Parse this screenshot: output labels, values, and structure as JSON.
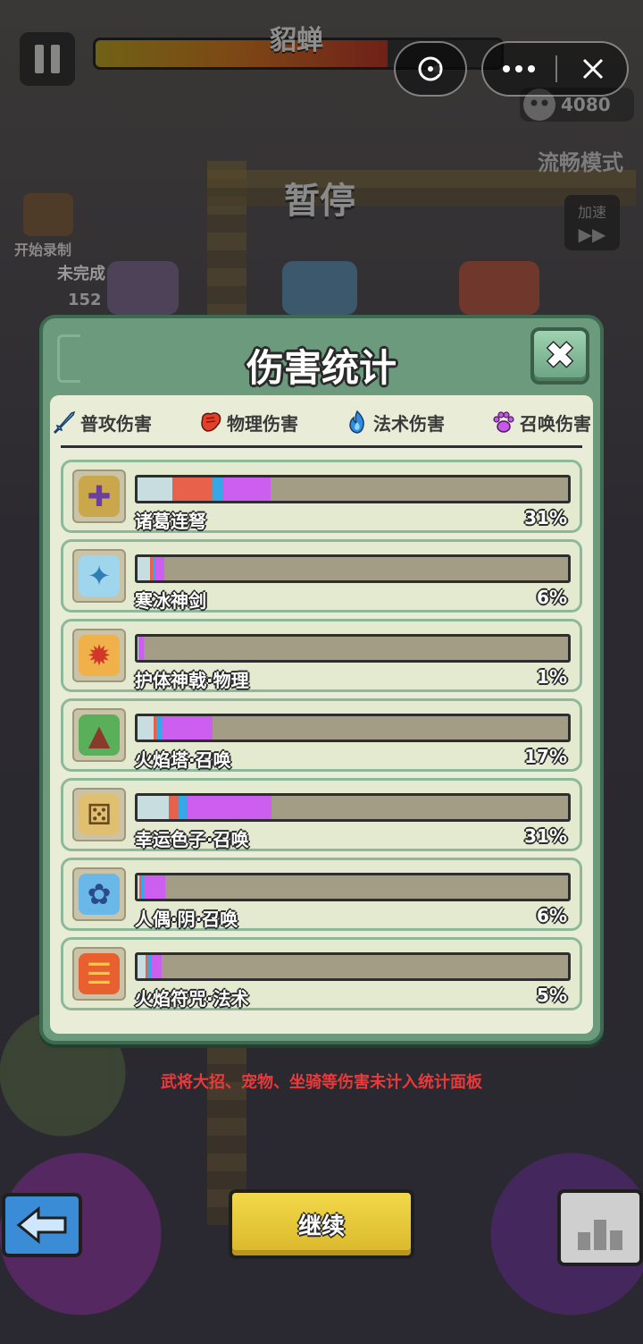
{
  "hud": {
    "boss_name": "貂蝉",
    "boss_hp_fraction": 0.72,
    "kill_count": "4080",
    "smooth_mode_label": "流畅模式",
    "speed_label": "加速",
    "record_label": "开始录制",
    "unfinished_label": "未完成",
    "count_value": "152",
    "pause_title": "暂停"
  },
  "dialog": {
    "title": "伤害统计",
    "legend": [
      {
        "label": "普攻伤害",
        "icon": "sword-icon",
        "color": "#37a8e6"
      },
      {
        "label": "物理伤害",
        "icon": "fist-icon",
        "color": "#e8614a"
      },
      {
        "label": "法术伤害",
        "icon": "flame-icon",
        "color": "#37a8e6"
      },
      {
        "label": "召唤伤害",
        "icon": "paw-icon",
        "color": "#cc5ff0"
      }
    ],
    "rows": [
      {
        "name": "诸葛连弩",
        "percent": "31%",
        "segments": {
          "basic": 8,
          "phys": 9.5,
          "magic": 2.5,
          "summon": 11
        }
      },
      {
        "name": "寒冰神剑",
        "percent": "6%",
        "segments": {
          "basic": 3,
          "phys": 0.5,
          "magic": 0.6,
          "summon": 2.2
        }
      },
      {
        "name": "护体神戟·物理",
        "percent": "1%",
        "segments": {
          "basic": 0.3,
          "phys": 0,
          "magic": 0,
          "summon": 1.2
        }
      },
      {
        "name": "火焰塔·召唤",
        "percent": "17%",
        "segments": {
          "basic": 3.8,
          "phys": 0.5,
          "magic": 1.2,
          "summon": 12
        }
      },
      {
        "name": "幸运色子·召唤",
        "percent": "31%",
        "segments": {
          "basic": 7.3,
          "phys": 2.2,
          "magic": 2.2,
          "summon": 19.5
        }
      },
      {
        "name": "人偶·阴·召唤",
        "percent": "6%",
        "segments": {
          "basic": 0.5,
          "phys": 0.4,
          "magic": 0.5,
          "summon": 5
        }
      },
      {
        "name": "火焰符咒·法术",
        "percent": "5%",
        "segments": {
          "basic": 1.8,
          "phys": 0.4,
          "magic": 1.2,
          "summon": 2.2
        }
      }
    ],
    "row_icons": [
      "crossbow-icon",
      "ice-sword-icon",
      "halberd-icon",
      "fire-tower-icon",
      "dice-icon",
      "doll-icon",
      "talisman-icon"
    ]
  },
  "note": "武将大招、宠物、坐骑等伤害未计入统计面板",
  "buttons": {
    "continue_label": "继续"
  },
  "colors": {
    "basic": "#c8dde0",
    "phys": "#e8614a",
    "magic": "#37a8e6",
    "summon": "#cc5ff0",
    "note": "#e83a3a",
    "continue": "#f2d84a"
  }
}
